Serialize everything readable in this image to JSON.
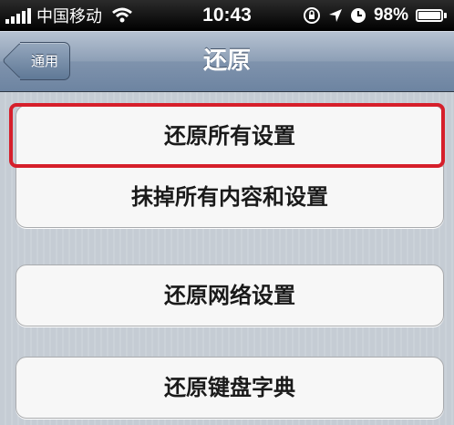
{
  "status_bar": {
    "carrier": "中国移动",
    "time": "10:43",
    "battery_percent": "98%",
    "battery_level": 0.98,
    "icons": [
      "signal-icon",
      "wifi-icon",
      "rotation-lock-icon",
      "location-icon",
      "alarm-icon",
      "battery-icon"
    ]
  },
  "nav": {
    "back_label": "通用",
    "title": "还原"
  },
  "groups": [
    {
      "items": [
        "还原所有设置",
        "抹掉所有内容和设置"
      ]
    },
    {
      "items": [
        "还原网络设置"
      ]
    },
    {
      "items": [
        "还原键盘字典"
      ]
    }
  ],
  "colors": {
    "highlight": "#d61f2b",
    "nav_bar": "#8d9fb6",
    "background": "#c5ccd4"
  }
}
